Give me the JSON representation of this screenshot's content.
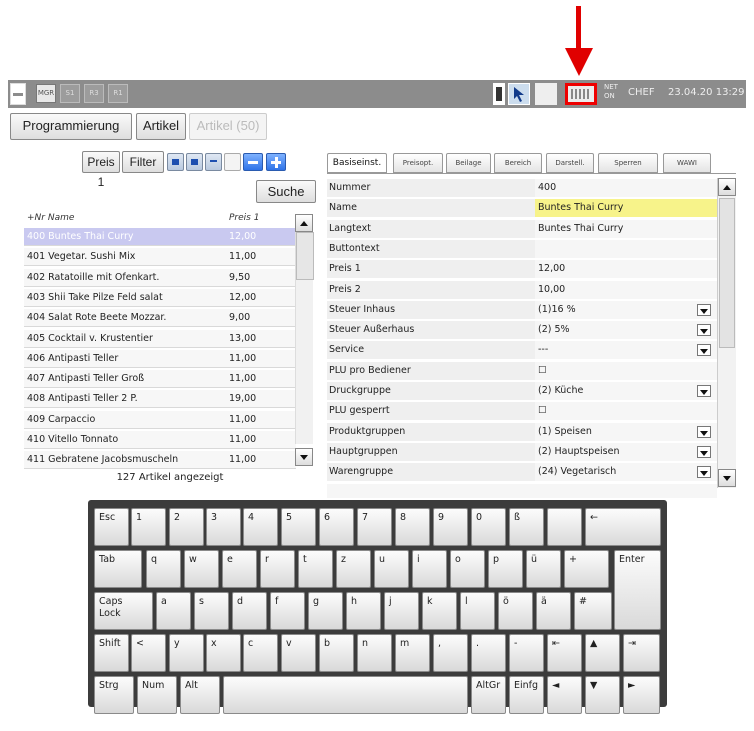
{
  "topbar": {
    "mode_buttons": [
      "MGR",
      "S1",
      "R3",
      "R1"
    ],
    "net_status": [
      "NET",
      "ON"
    ],
    "user": "CHEF",
    "datetime": "23.04.20 13:29"
  },
  "nav": {
    "programming": "Programmierung",
    "articles": "Artikel",
    "articles_count": "Artikel (50)"
  },
  "toolbar": {
    "price_filter": "Preis 1",
    "filter": "Filter",
    "search": "Suche"
  },
  "list": {
    "col_nr_name": "+Nr Name",
    "col_price": "Preis 1",
    "rows": [
      {
        "name": "400 Buntes Thai Curry",
        "price": "12,00"
      },
      {
        "name": "401 Vegetar. Sushi Mix",
        "price": "11,00"
      },
      {
        "name": "402 Ratatoille mit Ofenkart.",
        "price": "9,50"
      },
      {
        "name": "403 Shii Take Pilze Feld salat",
        "price": "12,00"
      },
      {
        "name": "404 Salat Rote Beete Mozzar.",
        "price": "9,00"
      },
      {
        "name": "405 Cocktail v. Krustentier",
        "price": "13,00"
      },
      {
        "name": "406 Antipasti Teller",
        "price": "11,00"
      },
      {
        "name": "407 Antipasti Teller Groß",
        "price": "11,00"
      },
      {
        "name": "408 Antipasti Teller 2 P.",
        "price": "19,00"
      },
      {
        "name": "409 Carpaccio",
        "price": "11,00"
      },
      {
        "name": "410 Vitello Tonnato",
        "price": "11,00"
      },
      {
        "name": "411 Gebratene Jacobsmuscheln",
        "price": "11,00"
      }
    ],
    "count": "127 Artikel angezeigt"
  },
  "tabs": [
    "Basiseinst.",
    "Preisopt.",
    "Beilage",
    "Bereich",
    "Darstell.",
    "Sperren",
    "WAWI"
  ],
  "properties": [
    {
      "label": "Nummer",
      "value": "400"
    },
    {
      "label": "Name",
      "value": "Buntes Thai Curry"
    },
    {
      "label": "Langtext",
      "value": "Buntes Thai Curry"
    },
    {
      "label": "Buttontext",
      "value": ""
    },
    {
      "label": "Preis 1",
      "value": "12,00"
    },
    {
      "label": "Preis 2",
      "value": "10,00"
    },
    {
      "label": "Steuer Inhaus",
      "value": "(1)16 %"
    },
    {
      "label": "Steuer Außerhaus",
      "value": "(2) 5%"
    },
    {
      "label": "Service",
      "value": "---"
    },
    {
      "label": "PLU pro Bediener",
      "value": "☐"
    },
    {
      "label": "Druckgruppe",
      "value": "(2) Küche"
    },
    {
      "label": "PLU gesperrt",
      "value": "☐"
    },
    {
      "label": "Produktgruppen",
      "value": "(1) Speisen"
    },
    {
      "label": "Hauptgruppen",
      "value": "(2) Hauptspeisen"
    },
    {
      "label": "Warengruppe",
      "value": "(24) Vegetarisch"
    }
  ],
  "keyboard": {
    "row1": [
      "Esc",
      "1",
      "2",
      "3",
      "4",
      "5",
      "6",
      "7",
      "8",
      "9",
      "0",
      "ß",
      "",
      "←"
    ],
    "row2": [
      "Tab",
      "q",
      "w",
      "e",
      "r",
      "t",
      "z",
      "u",
      "i",
      "o",
      "p",
      "ü",
      "+",
      "Enter"
    ],
    "row3": [
      "Caps\nLock",
      "a",
      "s",
      "d",
      "f",
      "g",
      "h",
      "j",
      "k",
      "l",
      "ö",
      "ä",
      "#"
    ],
    "row4": [
      "Shift",
      "<",
      "y",
      "x",
      "c",
      "v",
      "b",
      "n",
      "m",
      ",",
      ".",
      "-",
      "⇤",
      "▲",
      "⇥"
    ],
    "row5": [
      "Strg",
      "Num",
      "Alt",
      "",
      "AltGr",
      "Einfg",
      "◄",
      "▼",
      "►"
    ]
  },
  "colors": {
    "arrow": "#e00000",
    "topbar": "#8c8c8c",
    "selection": "#c9c9f0",
    "highlight": "#f7f38a"
  }
}
